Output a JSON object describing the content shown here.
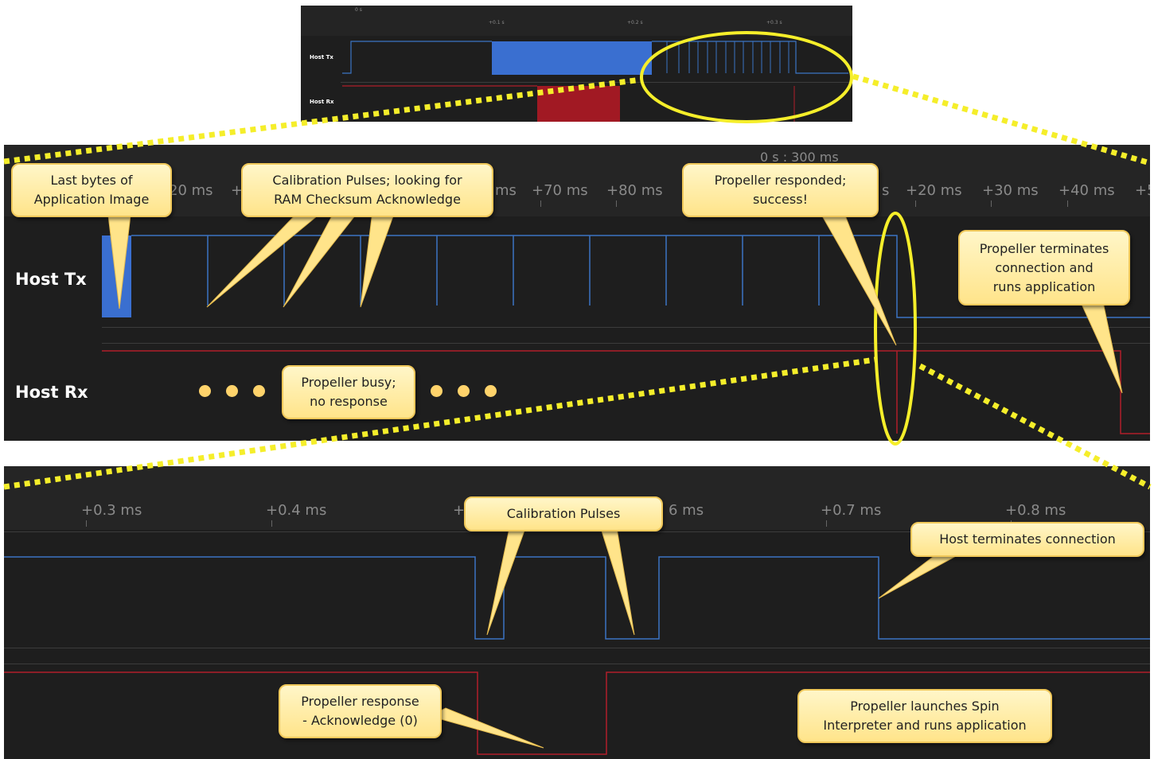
{
  "colors": {
    "tx_signal": "#3b74c4",
    "tx_fill": "#3a6fd0",
    "rx_signal": "#b01e2a",
    "rx_fill": "#a11923",
    "highlight": "#f5ee2a",
    "callout_bg": "#ffe48a",
    "panel_bg": "#1e1e1e"
  },
  "overview": {
    "ticks": [
      "0 s",
      "+0.1 s",
      "+0.2 s",
      "+0.3 s"
    ],
    "channels": [
      "Host Tx",
      "Host Rx"
    ]
  },
  "middle": {
    "header_time": "0 s : 300 ms",
    "ticks": [
      "20 ms",
      "+",
      "ms",
      "+70 ms",
      "+80 ms",
      "s",
      "+20 ms",
      "+30 ms",
      "+40 ms",
      "+5"
    ],
    "channels": [
      "Host Tx",
      "Host Rx"
    ],
    "callouts": {
      "last_bytes": [
        "Last bytes of",
        "Application Image"
      ],
      "calibration": [
        "Calibration Pulses; looking for",
        "RAM Checksum Acknowledge"
      ],
      "responded": [
        "Propeller responded;",
        "success!"
      ],
      "terminates": [
        "Propeller terminates",
        "connection and",
        "runs application"
      ],
      "busy": [
        "Propeller busy;",
        "no response"
      ]
    }
  },
  "bottom": {
    "ticks": [
      "+0.3 ms",
      "+0.4 ms",
      "+",
      "6 ms",
      "+0.7 ms",
      "+0.8 ms"
    ],
    "callouts": {
      "calibration": [
        "Calibration Pulses"
      ],
      "host_terminates": [
        "Host terminates connection"
      ],
      "response": [
        "Propeller response",
        "- Acknowledge (0)"
      ],
      "launches": [
        "Propeller launches Spin",
        "Interpreter and runs application"
      ]
    }
  }
}
